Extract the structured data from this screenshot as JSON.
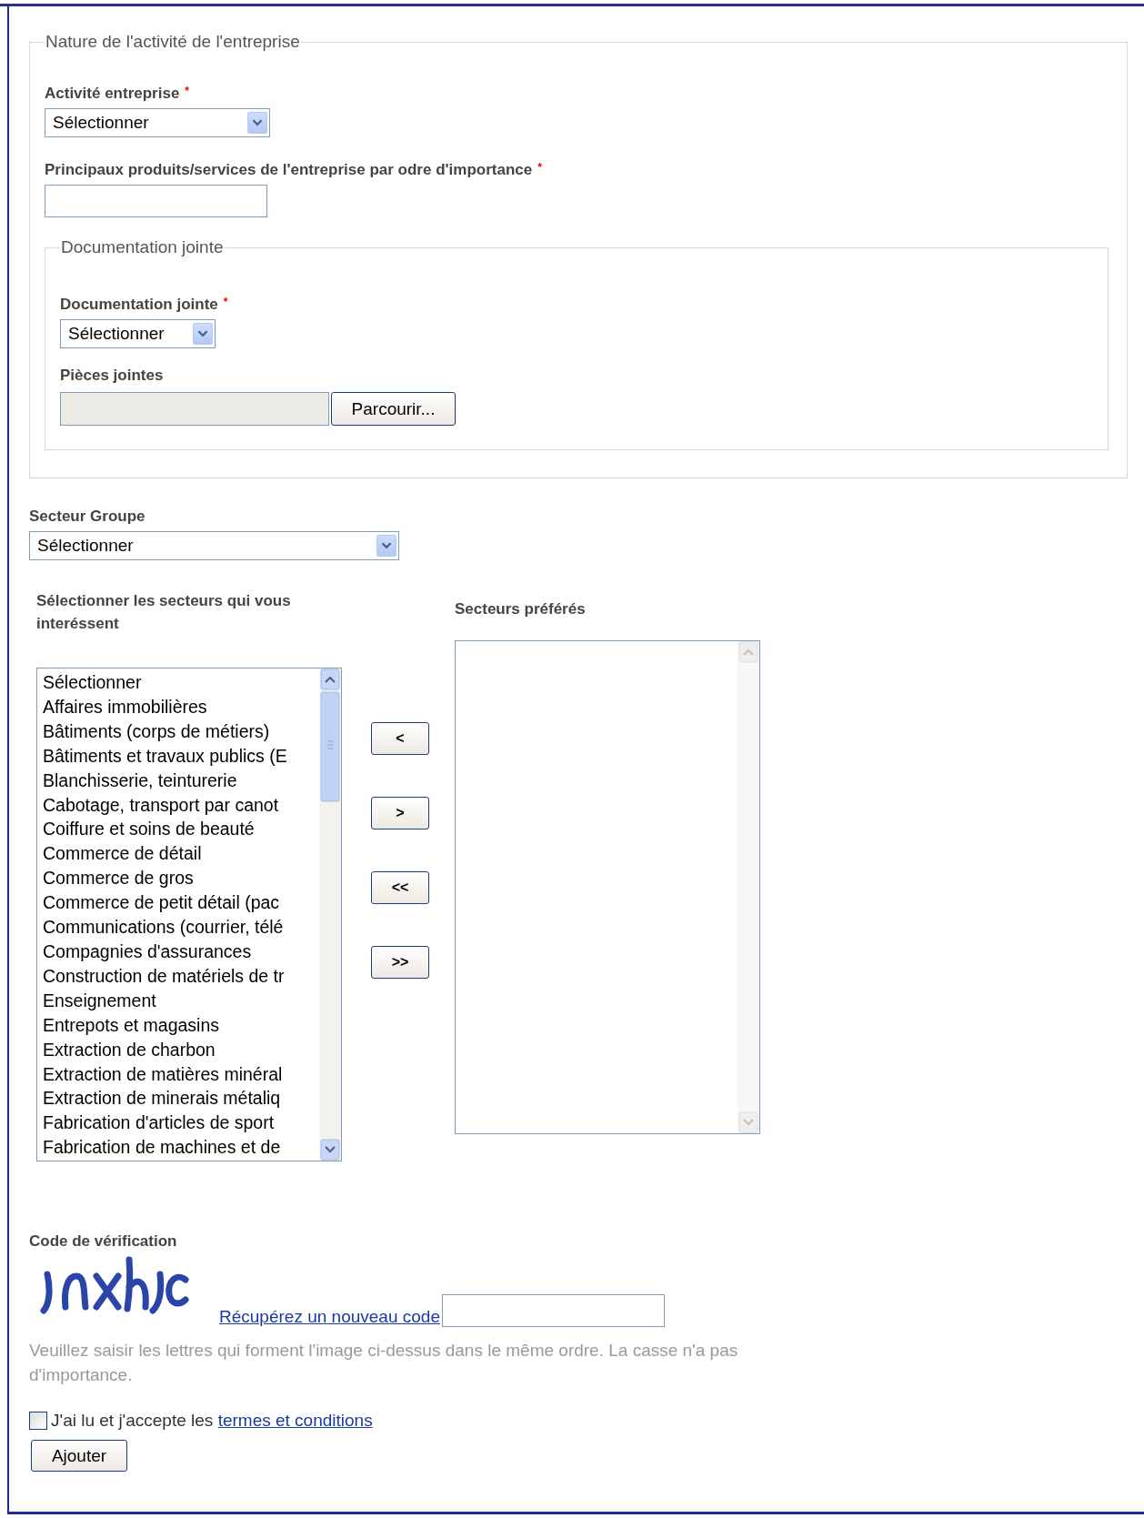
{
  "activity_fieldset": {
    "legend": "Nature de l'activité de l'entreprise",
    "activity_field": {
      "label": "Activité entreprise",
      "required_mark": "*",
      "value": "Sélectionner"
    },
    "products_field": {
      "label": "Principaux produits/services de l'entreprise par odre d'importance",
      "required_mark": "*"
    },
    "documentation_fieldset": {
      "legend": "Documentation jointe",
      "documentation_field": {
        "label": "Documentation jointe",
        "required_mark": "*",
        "value": "Sélectionner"
      },
      "attachments_field": {
        "label": "Pièces jointes",
        "button": "Parcourir..."
      }
    }
  },
  "sector_group": {
    "label": "Secteur Groupe",
    "value": "Sélectionner"
  },
  "sectors": {
    "available_label": "Sélectionner les secteurs qui vous interéssent",
    "preferred_label": "Secteurs préférés",
    "available": [
      "Sélectionner",
      "Affaires immobilières",
      "Bâtiments (corps de métiers)",
      "Bâtiments et travaux publics (E",
      "Blanchisserie, teinturerie",
      "Cabotage, transport par canot",
      "Coiffure et soins de beauté",
      "Commerce de détail",
      "Commerce de gros",
      "Commerce de petit détail (pac",
      "Communications (courrier, télé",
      "Compagnies d'assurances",
      "Construction de matériels de tr",
      "Enseignement",
      "Entrepots et magasins",
      "Extraction de charbon",
      "Extraction de matières minéral",
      "Extraction de minerais métaliq",
      "Fabrication d'articles de sport",
      "Fabrication de machines et de"
    ],
    "move_buttons": [
      "<",
      ">",
      "<<",
      ">>"
    ]
  },
  "verification": {
    "label": "Code de vérification",
    "refresh_link": "Récupérez un nouveau code",
    "hint": "Veuillez saisir les lettres qui forment l'image ci-dessus dans le même ordre. La casse n'a pas d'importance."
  },
  "terms": {
    "checked": false,
    "text": "J'ai lu et j'accepte les ",
    "link": "termes et conditions"
  },
  "submit_button": "Ajouter"
}
